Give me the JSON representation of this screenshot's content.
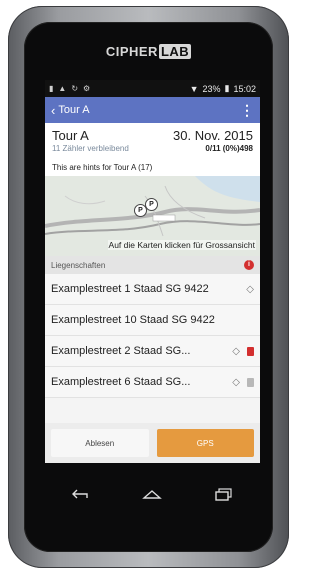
{
  "device": {
    "brand_a": "CIPHER",
    "brand_b": "LAB"
  },
  "status": {
    "battery": "23%",
    "time": "15:02"
  },
  "appbar": {
    "back_label": "Tour A"
  },
  "tour": {
    "name": "Tour A",
    "date": "30. Nov. 2015",
    "remaining": "11 Zähler verbleibend",
    "progress": "0/11 (0%)498",
    "hints": "This are hints for Tour A (17)"
  },
  "map": {
    "caption": "Auf die Karten klicken für Grossansicht",
    "pins": [
      "P",
      "P"
    ]
  },
  "section": {
    "title": "Liegenschaften",
    "info_glyph": "i"
  },
  "properties": [
    {
      "label": "Examplestreet 1 Staad SG 9422",
      "diamond": true,
      "doc": ""
    },
    {
      "label": "Examplestreet 10 Staad SG 9422",
      "diamond": false,
      "doc": ""
    },
    {
      "label": "Examplestreet 2 Staad SG...",
      "diamond": true,
      "doc": "red"
    },
    {
      "label": "Examplestreet 6 Staad SG...",
      "diamond": true,
      "doc": "gray"
    }
  ],
  "buttons": {
    "ablesen": "Ablesen",
    "gps": "GPS"
  },
  "colors": {
    "appbar": "#5d73c2",
    "gps": "#e59a3f",
    "info": "#d32f2f"
  }
}
